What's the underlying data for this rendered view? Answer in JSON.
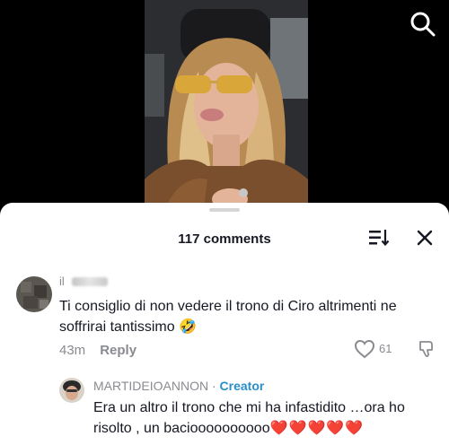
{
  "video": {
    "description": "selfie video frame"
  },
  "header": {
    "search_icon": "search-icon"
  },
  "sheet": {
    "title": "117 comments",
    "sort_icon": "sort-icon",
    "close_icon": "close-icon"
  },
  "comments": [
    {
      "username": "il",
      "text": "Ti consiglio di non vedere il trono di Ciro altrimenti ne soffrirai tantissimo 🤣",
      "time": "43m",
      "reply_label": "Reply",
      "likes": "61"
    }
  ],
  "reply": {
    "username": "MARTIDEIOANNON",
    "separator": " · ",
    "badge": "Creator",
    "text": "Era un altro il trono che mi ha infastidito …ora ho risolto , un bacioooooooooo",
    "hearts": "❤️❤️❤️❤️❤️"
  },
  "colors": {
    "accent": "#2b8fc9",
    "muted": "#8a8b91",
    "text": "#161823"
  }
}
